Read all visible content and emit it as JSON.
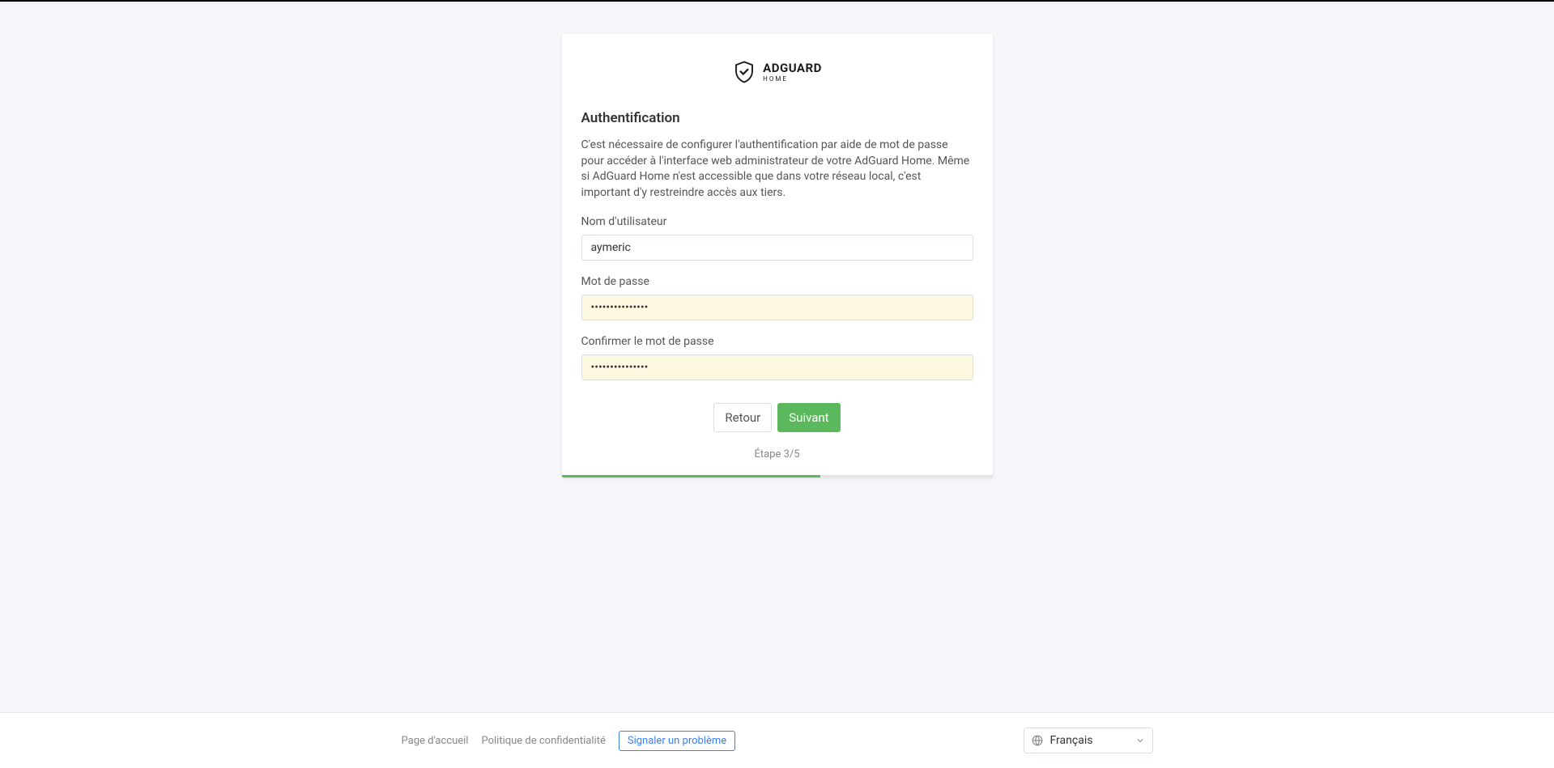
{
  "logo": {
    "name": "ADGUARD",
    "sub": "HOME"
  },
  "card": {
    "title": "Authentification",
    "description": "C'est nécessaire de configurer l'authentification par aide de mot de passe pour accéder à l'interface web administrateur de votre AdGuard Home. Même si AdGuard Home n'est accessible que dans votre réseau local, c'est important d'y restreindre accès aux tiers."
  },
  "form": {
    "username_label": "Nom d'utilisateur",
    "username_value": "aymeric",
    "password_label": "Mot de passe",
    "password_value": "•••••••••••••••",
    "confirm_label": "Confirmer le mot de passe",
    "confirm_value": "•••••••••••••••"
  },
  "buttons": {
    "back": "Retour",
    "next": "Suivant"
  },
  "step": {
    "label": "Étape 3/5",
    "current": 3,
    "total": 5
  },
  "footer": {
    "home": "Page d'accueil",
    "privacy": "Politique de confidentialité",
    "report": "Signaler un problème",
    "language": "Français"
  }
}
